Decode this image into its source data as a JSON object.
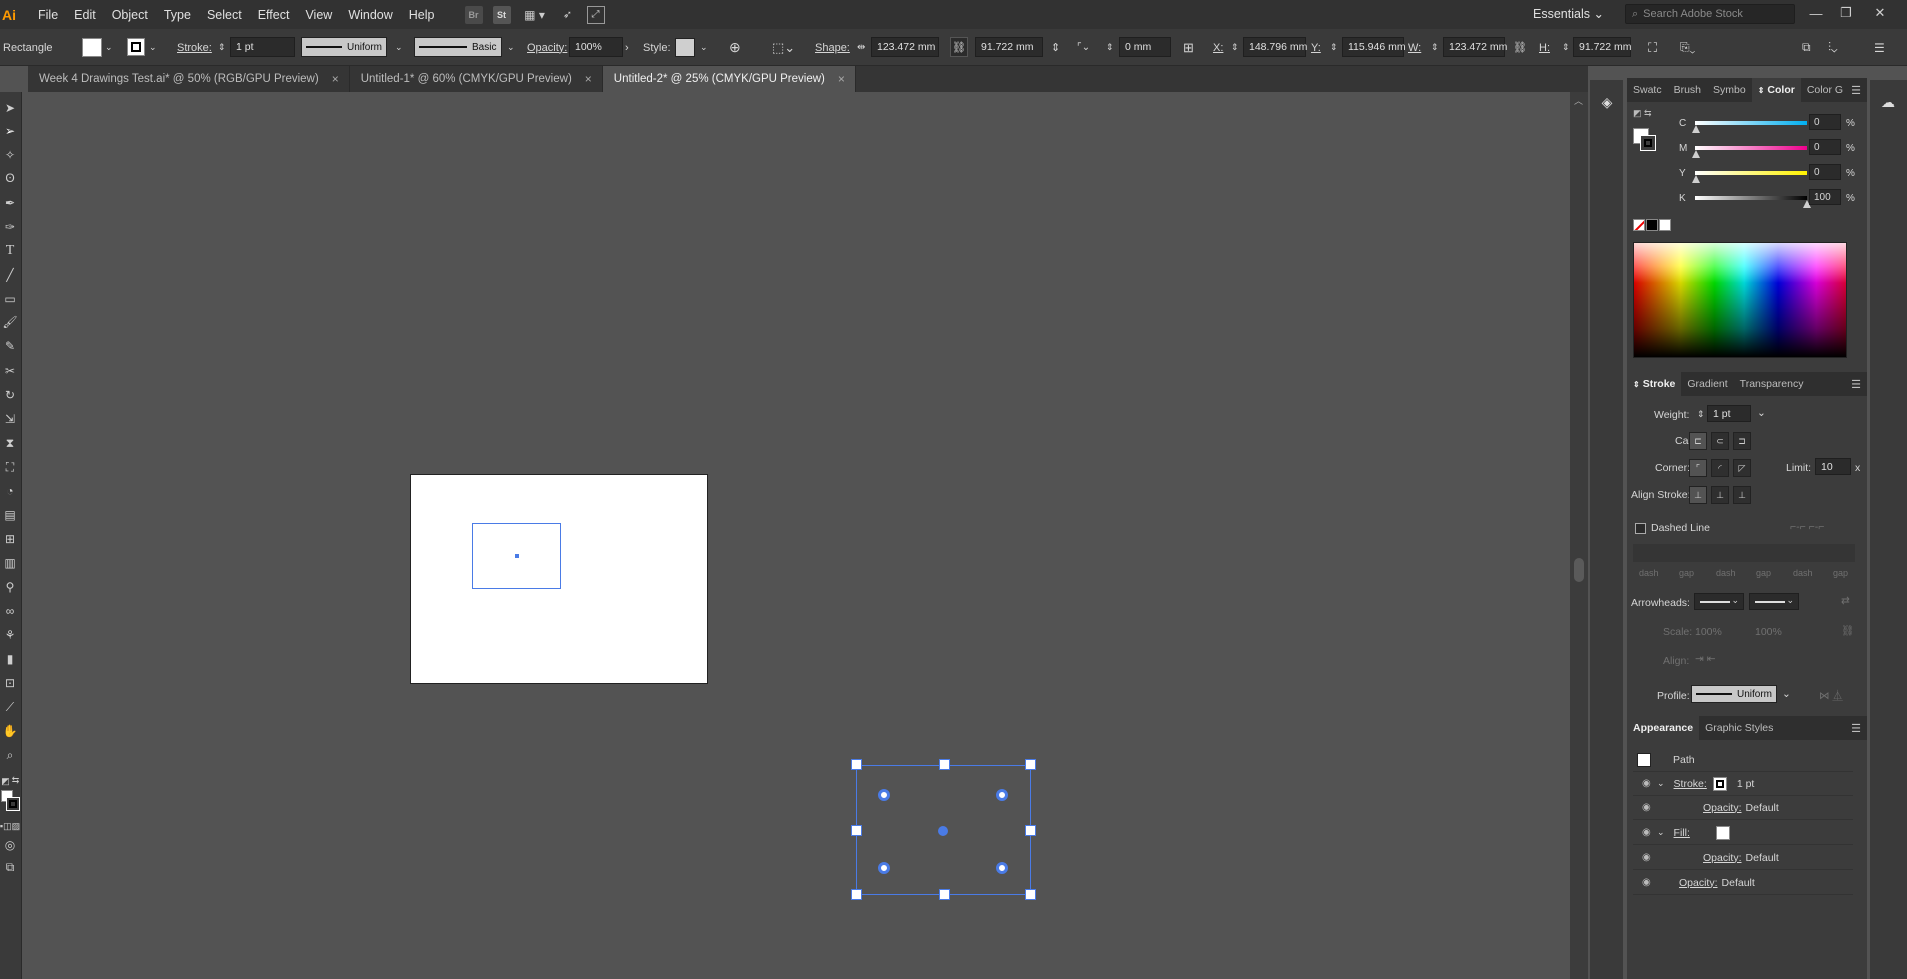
{
  "menubar": {
    "logo": "Ai",
    "items": [
      "File",
      "Edit",
      "Object",
      "Type",
      "Select",
      "Effect",
      "View",
      "Window",
      "Help"
    ],
    "bridge_icon": "Br",
    "stock_icon": "St",
    "workspace": "Essentials",
    "search_placeholder": "Search Adobe Stock"
  },
  "control_bar": {
    "tool_name": "Rectangle",
    "stroke_label": "Stroke:",
    "stroke_weight": "1 pt",
    "profile": "Uniform",
    "brush": "Basic",
    "opacity_label": "Opacity:",
    "opacity": "100%",
    "style_label": "Style:",
    "shape_label": "Shape:",
    "shape_w": "123.472 mm",
    "shape_h": "91.722 mm",
    "corner": "0 mm",
    "x_label": "X:",
    "x": "148.796 mm",
    "y_label": "Y:",
    "y": "115.946 mm",
    "w_label": "W:",
    "w": "123.472 mm",
    "h_label": "H:",
    "h": "91.722 mm"
  },
  "tabs": [
    {
      "label": "Week 4 Drawings Test.ai* @ 50% (RGB/GPU Preview)",
      "close": "×"
    },
    {
      "label": "Untitled-1* @ 60% (CMYK/GPU Preview)",
      "close": "×"
    },
    {
      "label": "Untitled-2* @ 25% (CMYK/GPU Preview)",
      "close": "×"
    }
  ],
  "color_panel": {
    "tabs": [
      "Swatc",
      "Brush",
      "Symbo",
      "Color",
      "Color G"
    ],
    "active_tab": "Color",
    "channels": [
      {
        "label": "C",
        "value": "0",
        "unit": "%",
        "color": "#00aeef",
        "level": 0
      },
      {
        "label": "M",
        "value": "0",
        "unit": "%",
        "color": "#ec008c",
        "level": 0
      },
      {
        "label": "Y",
        "value": "0",
        "unit": "%",
        "color": "#fff200",
        "level": 0
      },
      {
        "label": "K",
        "value": "100",
        "unit": "%",
        "color": "#000000",
        "level": 1
      }
    ]
  },
  "stroke_panel": {
    "tabs": [
      "Stroke",
      "Gradient",
      "Transparency"
    ],
    "weight_label": "Weight:",
    "weight": "1 pt",
    "cap_label": "Cap:",
    "corner_label": "Corner:",
    "limit_label": "Limit:",
    "limit": "10",
    "limit_unit": "x",
    "align_label": "Align Stroke:",
    "dashed_label": "Dashed Line",
    "dash_labels": [
      "dash",
      "gap",
      "dash",
      "gap",
      "dash",
      "gap"
    ],
    "arrowheads_label": "Arrowheads:",
    "scale_label": "Scale:",
    "scale_values": [
      "100%",
      "100%"
    ],
    "align_arrow_label": "Align:",
    "profile_label": "Profile:",
    "profile": "Uniform"
  },
  "appearance_panel": {
    "tabs": [
      "Appearance",
      "Graphic Styles"
    ],
    "object": "Path",
    "stroke_label": "Stroke:",
    "stroke_value": "1 pt",
    "fill_label": "Fill:",
    "opacity_label": "Opacity:",
    "opacity_value": "Default"
  },
  "colors": {
    "selection": "#4a7be6",
    "app_bg": "#535353",
    "panel_bg": "#3c3c3c",
    "logo": "#ff9a00"
  }
}
